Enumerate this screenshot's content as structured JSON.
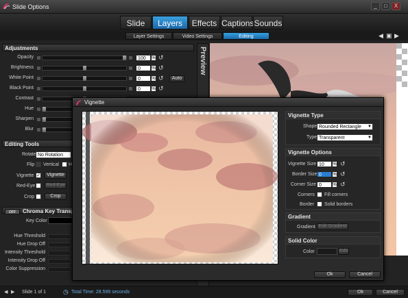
{
  "window": {
    "title": "Slide Options",
    "minimize": "_",
    "maximize": "□",
    "close": "X"
  },
  "tabs": [
    {
      "label": "Slide",
      "active": false
    },
    {
      "label": "Layers",
      "active": true
    },
    {
      "label": "Effects",
      "active": false
    },
    {
      "label": "Captions",
      "active": false
    },
    {
      "label": "Sounds",
      "active": false
    }
  ],
  "subtabs": [
    {
      "label": "Layer Settings",
      "active": false
    },
    {
      "label": "Video Settings",
      "active": false
    },
    {
      "label": "Editing",
      "active": true
    }
  ],
  "adjustments": {
    "header": "Adjustments",
    "rows": [
      {
        "label": "Opacity",
        "value": "100",
        "unit": "%",
        "level": 1.0
      },
      {
        "label": "Brightness",
        "value": "0",
        "unit": "%",
        "level": 0.5
      },
      {
        "label": "White Point",
        "value": "0",
        "unit": "%",
        "level": 0.5
      },
      {
        "label": "Black Point",
        "value": "0",
        "unit": "%",
        "level": 0.5
      },
      {
        "label": "Contrast",
        "value": "",
        "unit": "",
        "level": 0.5
      },
      {
        "label": "Hue",
        "value": "",
        "unit": "",
        "level": 0.0
      },
      {
        "label": "Sharpen",
        "value": "",
        "unit": "",
        "level": 0.0
      },
      {
        "label": "Blur",
        "value": "",
        "unit": "",
        "level": 0.0
      }
    ],
    "auto_label": "Auto"
  },
  "editing_tools": {
    "header": "Editing Tools",
    "rotate_label": "Rotate",
    "rotate_value": "No Rotation",
    "flip_label": "Flip",
    "vertical_label": "Vertical",
    "horizontal_label": "H",
    "vignette_label": "Vignette",
    "vignette_button": "Vignette",
    "redeye_label": "Red-Eye",
    "redeye_button": "Red-Eye",
    "crop_label": "Crop",
    "crop_button": "Crop"
  },
  "chroma": {
    "toggle": "OFF",
    "header": "Chroma Key Transp",
    "key_color_label": "Key Color",
    "rows": [
      "Hue Threshold",
      "Hue Drop Off",
      "Intensity Threshold",
      "Intensity Drop Off",
      "Color Suppression"
    ]
  },
  "preview": {
    "label": "Preview"
  },
  "bottom": {
    "slide_info": "Slide 1 of 1",
    "total_time": "Total Time: 28.599 seconds",
    "ok": "Ok",
    "cancel": "Cancel"
  },
  "vignette_dialog": {
    "title": "Vignette",
    "type_group": {
      "header": "Vignette Type",
      "shape_label": "Shape",
      "shape_value": "Rounded Rectangle",
      "type_label": "Type",
      "type_value": "Transparent"
    },
    "options_group": {
      "header": "Vignette Options",
      "size_label": "Vignette Size",
      "size_value": "10",
      "border_label": "Border Size",
      "border_value": "0",
      "corner_label": "Corner Size",
      "corner_value": "0",
      "unit": "%",
      "corners_label": "Corners",
      "fill_corners": "Fill corners",
      "border_label2": "Border",
      "solid_borders": "Solid borders"
    },
    "gradient_group": {
      "header": "Gradient",
      "gradient_label": "Gradient",
      "edit_button": "Edit Gradient"
    },
    "solid_group": {
      "header": "Solid Color",
      "color_label": "Color",
      "edit_button": "Edit"
    },
    "ok": "Ok",
    "cancel": "Cancel"
  },
  "colors": {
    "accent": "#2a8ad0",
    "panel": "#2b2b2b",
    "sky": "#e6b49c"
  }
}
